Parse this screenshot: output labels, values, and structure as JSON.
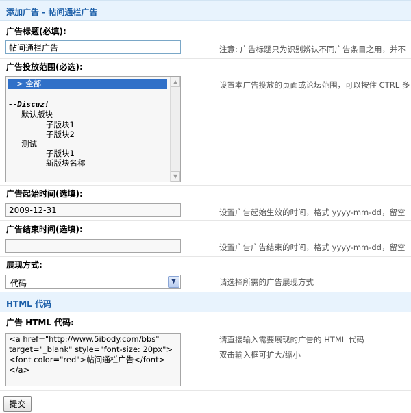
{
  "sections": {
    "add_ad": "添加广告 - 帖间通栏广告",
    "html_code": "HTML 代码"
  },
  "fields": {
    "title": {
      "label": "广告标题(必填):",
      "value": "帖间通栏广告",
      "hint": "注意: 广告标题只为识别辨认不同广告条目之用，并不"
    },
    "scope": {
      "label": "广告投放范围(必选):",
      "hint": "设置本广告投放的页面或论坛范围，可以按住 CTRL 多",
      "options": [
        "> 全部",
        "--Discuz!",
        "默认版块",
        "子版块1",
        "子版块2",
        "测试",
        "子版块1",
        "新版块名称"
      ]
    },
    "start_time": {
      "label": "广告起始时间(选填):",
      "value": "2009-12-31",
      "hint": "设置广告起始生效的时间，格式 yyyy-mm-dd，留空"
    },
    "end_time": {
      "label": "广告结束时间(选填):",
      "value": "",
      "hint": "设置广告广告结束的时间，格式 yyyy-mm-dd，留空"
    },
    "display_mode": {
      "label": "展现方式:",
      "value": "代码",
      "hint": "请选择所需的广告展现方式"
    },
    "html": {
      "label": "广告 HTML 代码:",
      "value": "<a href=\"http://www.5ibody.com/bbs\" target=\"_blank\" style=\"font-size: 20px\"><font color=\"red\">帖间通栏广告</font></a>",
      "hint1": "请直接输入需要展现的广告的 HTML 代码",
      "hint2": "双击输入框可扩大/缩小"
    }
  },
  "submit_label": "提交",
  "colors": {
    "accent": "#1b5ea8",
    "header_bg": "#e8f3fd",
    "selection": "#3070c8"
  }
}
